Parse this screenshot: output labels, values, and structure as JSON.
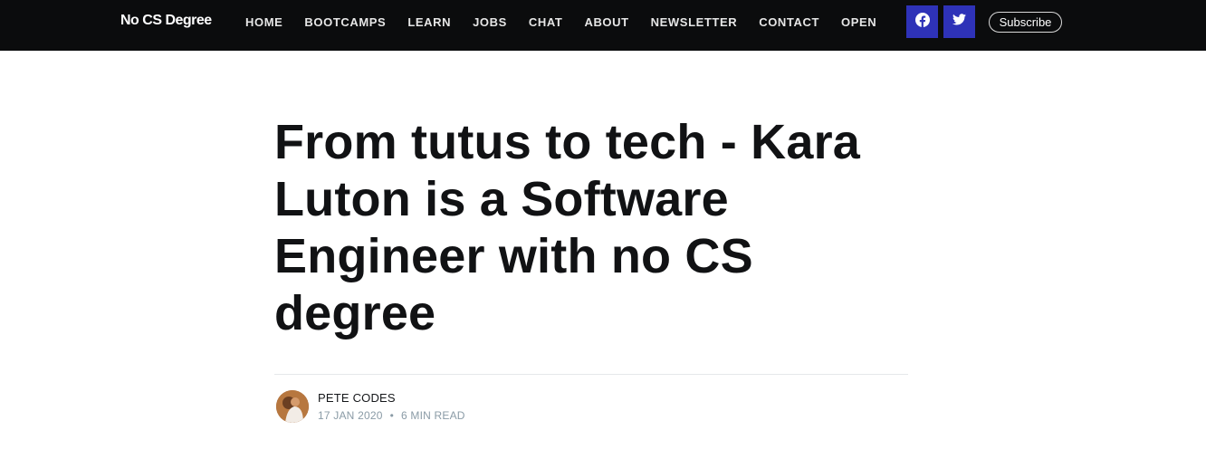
{
  "header": {
    "brand": "No CS Degree",
    "nav": [
      "HOME",
      "BOOTCAMPS",
      "LEARN",
      "JOBS",
      "CHAT",
      "ABOUT",
      "NEWSLETTER",
      "CONTACT",
      "OPEN"
    ],
    "social": [
      {
        "icon": "facebook-icon"
      },
      {
        "icon": "twitter-icon"
      }
    ],
    "subscribe_label": "Subscribe"
  },
  "post": {
    "title": "From tutus to tech - Kara Luton is a Software Engineer with no CS degree",
    "author": "PETE CODES",
    "date": "17 JAN 2020",
    "separator": "•",
    "read_time": "6 MIN READ"
  },
  "colors": {
    "header_bg": "#0b0c0d",
    "social_bg": "#2e32b8",
    "title": "#111214",
    "meta": "#8a9ba6"
  }
}
